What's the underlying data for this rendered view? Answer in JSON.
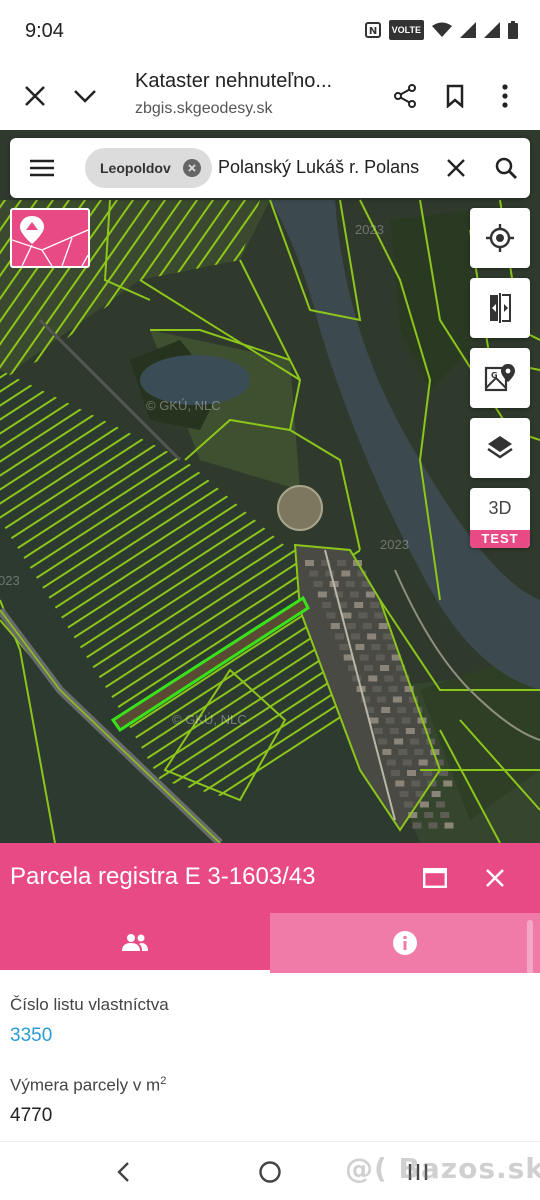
{
  "status_bar": {
    "time": "9:04",
    "volte": "VOLTE"
  },
  "browser": {
    "page_title": "Kataster nehnuteľno...",
    "url": "zbgis.skgeodesy.sk"
  },
  "search": {
    "chip_label": "Leopoldov",
    "query": "Polanský Lukáš r. Polans"
  },
  "map": {
    "watermark_1": "© GKÚ, NLC",
    "watermark_2": "© GKÚ, NLC",
    "year_1": "2023",
    "year_2": "2023",
    "year_3": "2023",
    "year_4": "023",
    "colors": {
      "parcel_line": "#8cc61a",
      "selected_parcel": "#39e21a",
      "river": "#3c4a4f",
      "accent": "#e84a86"
    }
  },
  "map_controls": {
    "btn_3d_label": "3D",
    "btn_3d_badge": "TEST"
  },
  "panel": {
    "title": "Parcela registra E 3-1603/43",
    "fields": [
      {
        "label": "Číslo listu vlastníctva",
        "value": "3350"
      },
      {
        "label_main": "Výmera parcely v m",
        "label_sup": "2",
        "value": "4770"
      }
    ]
  },
  "watermark": "@( Bazos.sk"
}
